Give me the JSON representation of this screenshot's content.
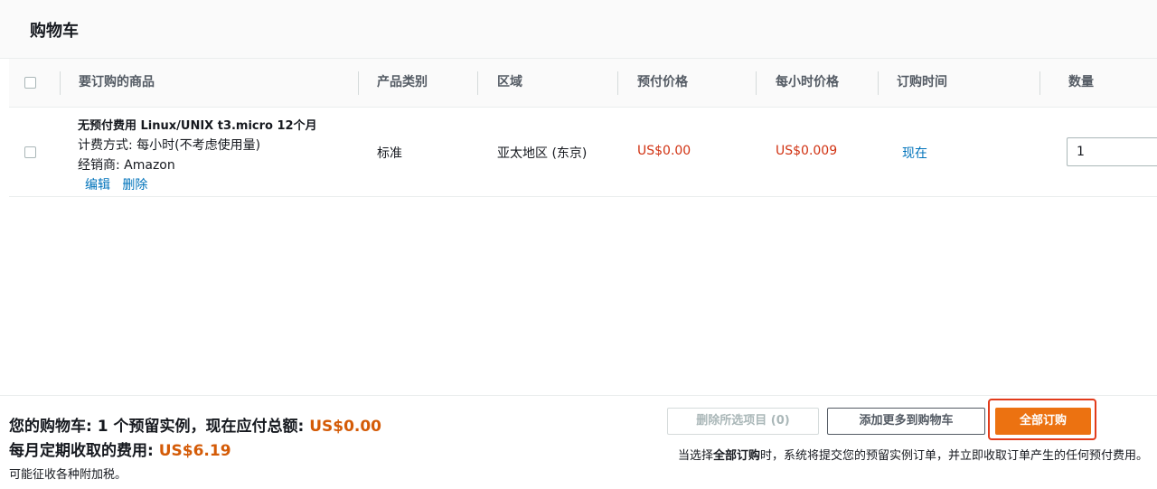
{
  "page_title": "购物车",
  "table": {
    "headers": [
      "要订购的商品",
      "产品类别",
      "区域",
      "预付价格",
      "每小时价格",
      "订购时间",
      "数量"
    ],
    "row": {
      "title": "无预付费用 Linux/UNIX t3.micro 12个月",
      "billing": "计费方式: 每小时(不考虑使用量)",
      "seller": "经销商: Amazon",
      "edit_label": "编辑",
      "delete_label": "删除",
      "category": "标准",
      "region": "亚太地区 (东京)",
      "upfront_price": "US$0.00",
      "hourly_price": "US$0.009",
      "order_time": "现在",
      "quantity": "1"
    }
  },
  "footer": {
    "summary_prefix": "您的购物车: 1 个预留实例，现在应付总额: ",
    "summary_amount": "US$0.00",
    "monthly_prefix": "每月定期收取的费用: ",
    "monthly_amount": "US$6.19",
    "tax_note": "可能征收各种附加税。",
    "delete_selected_label": "删除所选项目 (0)",
    "add_more_label": "添加更多到购物车",
    "order_all_label": "全部订购",
    "note_prefix": "当选择",
    "note_bold": "全部订购",
    "note_suffix": "时，系统将提交您的预留实例订单，并立即收取订单产生的任何预付费用。"
  },
  "colors": {
    "price": "#d13212",
    "total": "#d45b07",
    "link": "#0073bb",
    "primary_button": "#ec7211",
    "highlight_border": "#e23b1b"
  }
}
